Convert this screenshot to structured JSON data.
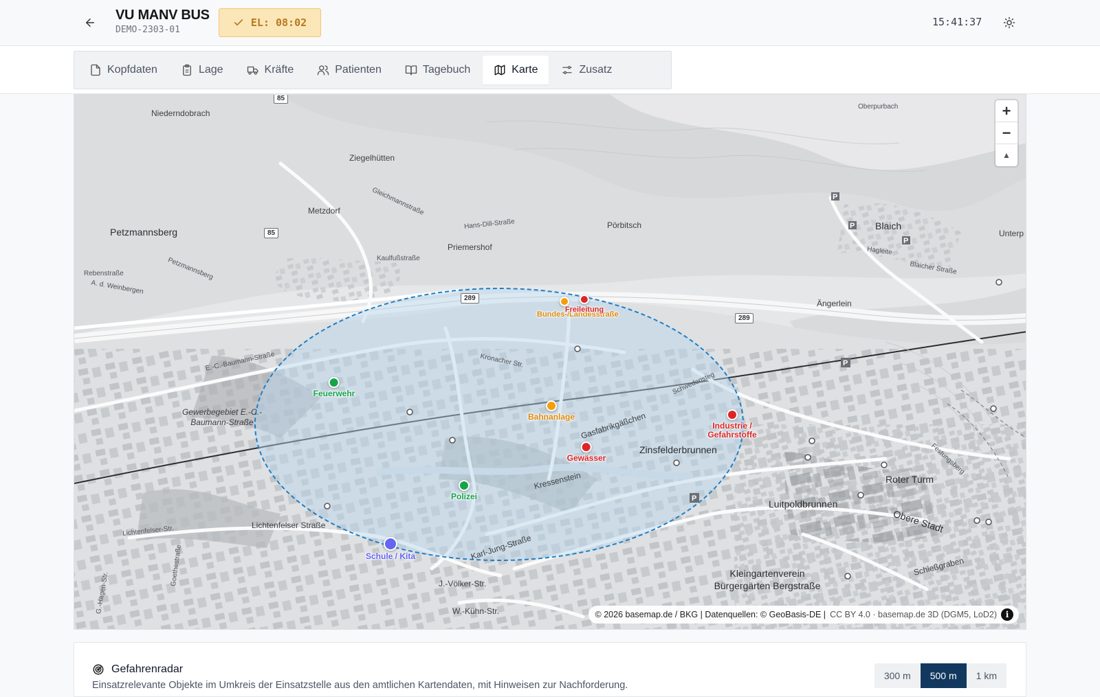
{
  "header": {
    "title": "VU MANV BUS",
    "subtitle": "DEMO-2303-01",
    "el_badge": "EL: 08:02",
    "clock": "15:41:37",
    "colors": {
      "badge_bg": "#fbe6b8",
      "badge_text": "#b7791f"
    }
  },
  "tabs": [
    {
      "label": "Kopfdaten",
      "icon": "file-icon"
    },
    {
      "label": "Lage",
      "icon": "clipboard-icon"
    },
    {
      "label": "Kräfte",
      "icon": "truck-icon"
    },
    {
      "label": "Patienten",
      "icon": "users-icon"
    },
    {
      "label": "Tagebuch",
      "icon": "book-open-icon"
    },
    {
      "label": "Karte",
      "icon": "map-icon",
      "active": true
    },
    {
      "label": "Zusatz",
      "icon": "sliders-icon"
    }
  ],
  "map": {
    "labels": {
      "niederndobrach": "Niederndobrach",
      "ziegelhuetten": "Ziegelhütten",
      "metzdorf": "Metzdorf",
      "petzmannsberg": "Petzmannsberg",
      "priemershof": "Priemershof",
      "poerbitsch": "Pörbitsch",
      "blaich": "Blaich",
      "oberpurbach": "Oberpurbach",
      "unterp": "Unterp",
      "gewerbegebiet": "Gewerbegebiet E.-C.-Baumann-Straße",
      "zinsfelderbrunnen": "Zinsfelderbrunnen",
      "luitpoldbrunnen": "Luitpoldbrunnen",
      "roter_turm": "Roter Turm",
      "kleingarten": "Kleingartenverein Bürgergärten Bergstraße",
      "lichtenfelser": "Lichtenfelser Straße",
      "lichtenfelser_str": "Lichtenfelser-Str.",
      "karl_jung": "Karl-Jung-Straße",
      "kressenstein": "Kressenstein",
      "kronacher": "Kronacher Str.",
      "gasfabrik": "Gasfabrikgäßchen",
      "schwedensteg": "Schwedensteg",
      "angerlein": "Ängerlein",
      "baumann_str": "E.-C.-Baumann-Straße",
      "hans_dill": "Hans-Dill-Straße",
      "kaulfuss": "Kaulfußstraße",
      "gleichmann": "Gleichmannstraße",
      "obere_stadt": "Obere Stadt",
      "schiessgraben": "Schießgraben",
      "j_voelker": "J.-Völker-Str.",
      "w_kuehn": "W.-Kühn-Str.",
      "goethestr": "Goethestraße",
      "g_hagen": "G.-Hagen-Str.",
      "blaicher": "Blaicher Straße",
      "festungsberg": "Festungsberg",
      "hagleite": "Hagleite",
      "rebenstr": "Rebenstraße",
      "weinbergen": "A. d. Weinbergen",
      "petzmannsberg_str": "Petzmannsberg"
    },
    "shields": {
      "b85_a": "85",
      "b85_b": "85",
      "b289_a": "289",
      "b289_b": "289"
    },
    "markers": [
      {
        "name": "feuerwehr",
        "label": "Feuerwehr",
        "color": "#16a34a"
      },
      {
        "name": "polizei",
        "label": "Polizei",
        "color": "#16a34a"
      },
      {
        "name": "schule",
        "label": "Schule / Kita",
        "color": "#6366f1"
      },
      {
        "name": "bahnanlage",
        "label": "Bahnanlage",
        "color": "#f59e0b"
      },
      {
        "name": "bundesstrasse",
        "label": "Bundes-/Landesstraße",
        "color": "#f59e0b"
      },
      {
        "name": "freileitung",
        "label": "Freileitung",
        "color": "#dc2626"
      },
      {
        "name": "gewaesser",
        "label": "Gewässer",
        "color": "#dc2626"
      },
      {
        "name": "industrie",
        "label": "Industrie / Gefahrstoffe",
        "color": "#dc2626"
      }
    ],
    "zoom": {
      "in": "+",
      "out": "−",
      "compass": "▲"
    },
    "attribution": {
      "main": "© 2026 basemap.de / BKG | Datenquellen: © GeoBasis-DE |",
      "license": "CC BY 4.0 · basemap.de 3D (DGM5, LoD2)",
      "info": "i"
    },
    "radius_color": "#1e7fc6"
  },
  "panel": {
    "title": "Gefahrenradar",
    "description": "Einsatzrelevante Objekte im Umkreis der Einsatzstelle aus den amtlichen Kartendaten, mit Hinweisen zur Nachforderung.",
    "ranges": [
      "300 m",
      "500 m",
      "1 km"
    ],
    "active_range": "500 m"
  }
}
